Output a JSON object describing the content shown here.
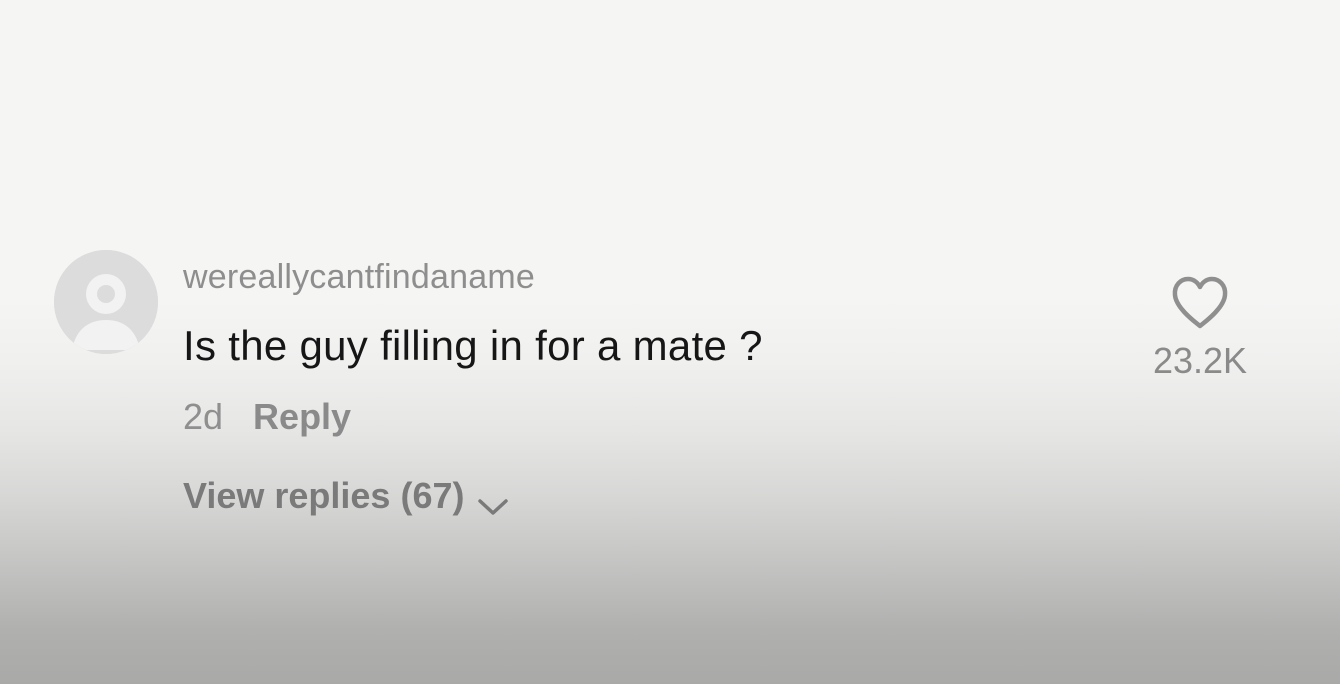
{
  "comment": {
    "username": "wereallycantfindaname",
    "text": "Is the guy filling in for a mate ?",
    "age": "2d",
    "reply_label": "Reply",
    "view_replies_label": "View replies (67)",
    "like_count": "23.2K"
  },
  "icons": {
    "avatar": "default-user-avatar",
    "like": "heart-outline-icon",
    "expand": "chevron-down-icon"
  },
  "colors": {
    "username": "#8e8e8e",
    "comment_text": "#161616",
    "secondary_text": "#8a8a8a",
    "avatar_bg": "#dcdcdc"
  }
}
